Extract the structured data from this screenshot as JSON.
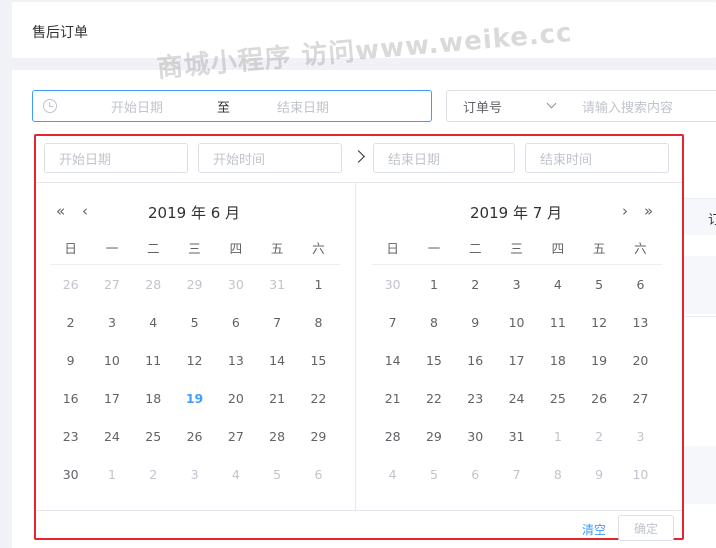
{
  "header": {
    "title": "售后订单"
  },
  "watermark": "商城小程序 访问www.weike.cc",
  "filters": {
    "range_start": "开始日期",
    "range_sep": "至",
    "range_end": "结束日期",
    "type_value": "订单号",
    "search_placeholder": "请输入搜索内容"
  },
  "table": {
    "header_fragment": "订"
  },
  "picker": {
    "start_date_placeholder": "开始日期",
    "start_time_placeholder": "开始时间",
    "end_date_placeholder": "结束日期",
    "end_time_placeholder": "结束时间",
    "left_title": "2019 年 6 月",
    "right_title": "2019 年 7 月",
    "nav_prev_year": "«",
    "nav_prev_month": "‹",
    "nav_next_month": "›",
    "nav_next_year": "»",
    "weekdays": [
      "日",
      "一",
      "二",
      "三",
      "四",
      "五",
      "六"
    ],
    "left_days": [
      [
        [
          "26",
          1
        ],
        [
          "27",
          1
        ],
        [
          "28",
          1
        ],
        [
          "29",
          1
        ],
        [
          "30",
          1
        ],
        [
          "31",
          1
        ],
        [
          "1",
          0
        ]
      ],
      [
        [
          "2",
          0
        ],
        [
          "3",
          0
        ],
        [
          "4",
          0
        ],
        [
          "5",
          0
        ],
        [
          "6",
          0
        ],
        [
          "7",
          0
        ],
        [
          "8",
          0
        ]
      ],
      [
        [
          "9",
          0
        ],
        [
          "10",
          0
        ],
        [
          "11",
          0
        ],
        [
          "12",
          0
        ],
        [
          "13",
          0
        ],
        [
          "14",
          0
        ],
        [
          "15",
          0
        ]
      ],
      [
        [
          "16",
          0
        ],
        [
          "17",
          0
        ],
        [
          "18",
          0
        ],
        [
          "19",
          2
        ],
        [
          "20",
          0
        ],
        [
          "21",
          0
        ],
        [
          "22",
          0
        ]
      ],
      [
        [
          "23",
          0
        ],
        [
          "24",
          0
        ],
        [
          "25",
          0
        ],
        [
          "26",
          0
        ],
        [
          "27",
          0
        ],
        [
          "28",
          0
        ],
        [
          "29",
          0
        ]
      ],
      [
        [
          "30",
          0
        ],
        [
          "1",
          1
        ],
        [
          "2",
          1
        ],
        [
          "3",
          1
        ],
        [
          "4",
          1
        ],
        [
          "5",
          1
        ],
        [
          "6",
          1
        ]
      ]
    ],
    "right_days": [
      [
        [
          "30",
          1
        ],
        [
          "1",
          0
        ],
        [
          "2",
          0
        ],
        [
          "3",
          0
        ],
        [
          "4",
          0
        ],
        [
          "5",
          0
        ],
        [
          "6",
          0
        ]
      ],
      [
        [
          "7",
          0
        ],
        [
          "8",
          0
        ],
        [
          "9",
          0
        ],
        [
          "10",
          0
        ],
        [
          "11",
          0
        ],
        [
          "12",
          0
        ],
        [
          "13",
          0
        ]
      ],
      [
        [
          "14",
          0
        ],
        [
          "15",
          0
        ],
        [
          "16",
          0
        ],
        [
          "17",
          0
        ],
        [
          "18",
          0
        ],
        [
          "19",
          0
        ],
        [
          "20",
          0
        ]
      ],
      [
        [
          "21",
          0
        ],
        [
          "22",
          0
        ],
        [
          "23",
          0
        ],
        [
          "24",
          0
        ],
        [
          "25",
          0
        ],
        [
          "26",
          0
        ],
        [
          "27",
          0
        ]
      ],
      [
        [
          "28",
          0
        ],
        [
          "29",
          0
        ],
        [
          "30",
          0
        ],
        [
          "31",
          0
        ],
        [
          "1",
          1
        ],
        [
          "2",
          1
        ],
        [
          "3",
          1
        ]
      ],
      [
        [
          "4",
          1
        ],
        [
          "5",
          1
        ],
        [
          "6",
          1
        ],
        [
          "7",
          1
        ],
        [
          "8",
          1
        ],
        [
          "9",
          1
        ],
        [
          "10",
          1
        ]
      ]
    ],
    "clear_label": "清空",
    "ok_label": "确定"
  },
  "colors": {
    "accent": "#409eff",
    "highlight_border": "#e3262d"
  }
}
